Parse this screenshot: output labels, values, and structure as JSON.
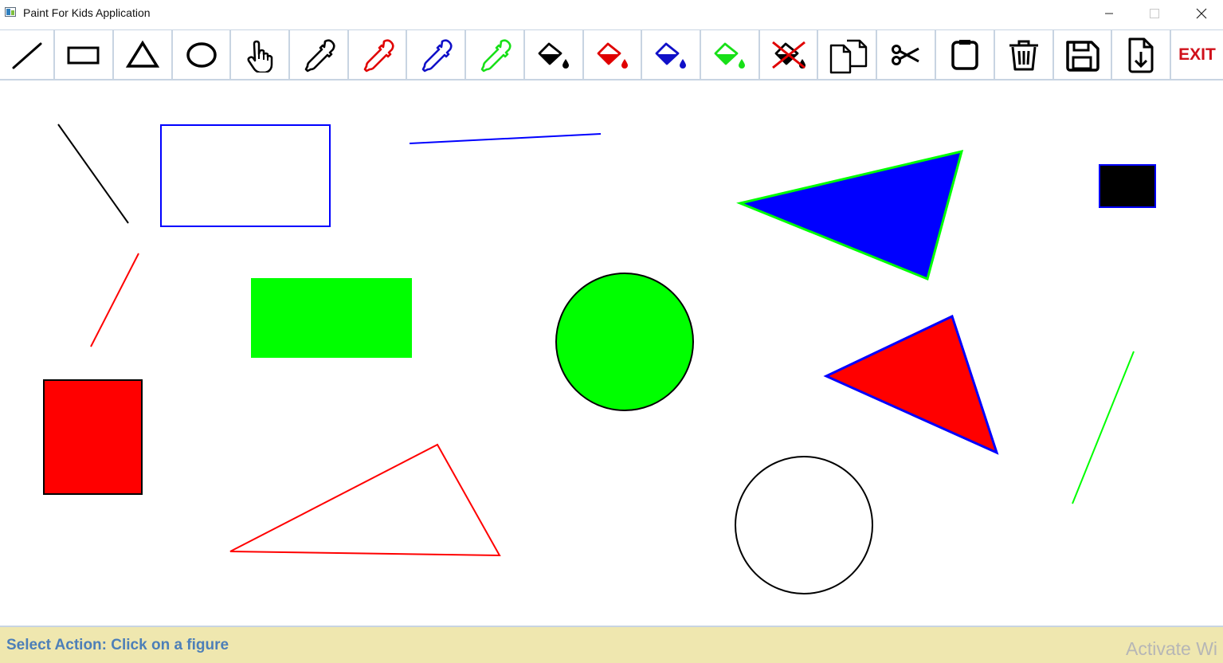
{
  "window": {
    "title": "Paint For Kids Application",
    "minimize_glyph": "—",
    "maximize_glyph": "☐",
    "close_glyph": "✕"
  },
  "toolbar": {
    "tools": [
      {
        "name": "draw-line-tool",
        "icon": "line-icon",
        "color": "#000000"
      },
      {
        "name": "draw-rectangle-tool",
        "icon": "rectangle-icon",
        "color": "#000000"
      },
      {
        "name": "draw-triangle-tool",
        "icon": "triangle-icon",
        "color": "#000000"
      },
      {
        "name": "draw-circle-tool",
        "icon": "circle-icon",
        "color": "#000000"
      },
      {
        "name": "select-tool",
        "icon": "hand-pointer-icon",
        "color": "#000000"
      },
      {
        "name": "pen-color-black",
        "icon": "eyedropper-icon",
        "color": "#000000"
      },
      {
        "name": "pen-color-red",
        "icon": "eyedropper-icon",
        "color": "#e00000"
      },
      {
        "name": "pen-color-blue",
        "icon": "eyedropper-icon",
        "color": "#0000d0"
      },
      {
        "name": "pen-color-green",
        "icon": "eyedropper-icon",
        "color": "#00dd00"
      },
      {
        "name": "fill-color-black",
        "icon": "paint-bucket-icon",
        "color": "#000000"
      },
      {
        "name": "fill-color-red",
        "icon": "paint-bucket-icon",
        "color": "#e00000"
      },
      {
        "name": "fill-color-blue",
        "icon": "paint-bucket-icon",
        "color": "#0000d0"
      },
      {
        "name": "fill-color-green",
        "icon": "paint-bucket-icon",
        "color": "#00dd00"
      },
      {
        "name": "no-fill-tool",
        "icon": "no-fill-icon",
        "color": "#000000"
      },
      {
        "name": "copy-tool",
        "icon": "copy-icon",
        "color": "#000000"
      },
      {
        "name": "cut-tool",
        "icon": "scissors-icon",
        "color": "#000000"
      },
      {
        "name": "paste-tool",
        "icon": "clipboard-icon",
        "color": "#000000"
      },
      {
        "name": "delete-tool",
        "icon": "trash-icon",
        "color": "#000000"
      },
      {
        "name": "save-tool",
        "icon": "floppy-disk-icon",
        "color": "#000000"
      },
      {
        "name": "load-tool",
        "icon": "file-download-icon",
        "color": "#000000"
      }
    ],
    "exit_label": "EXIT"
  },
  "canvas": {
    "colors": {
      "black": "#000000",
      "red": "#ff0000",
      "blue": "#0000ff",
      "green": "#00ff00"
    }
  },
  "status": {
    "message": "Select Action: Click on a figure",
    "watermark": "Activate Wi"
  }
}
